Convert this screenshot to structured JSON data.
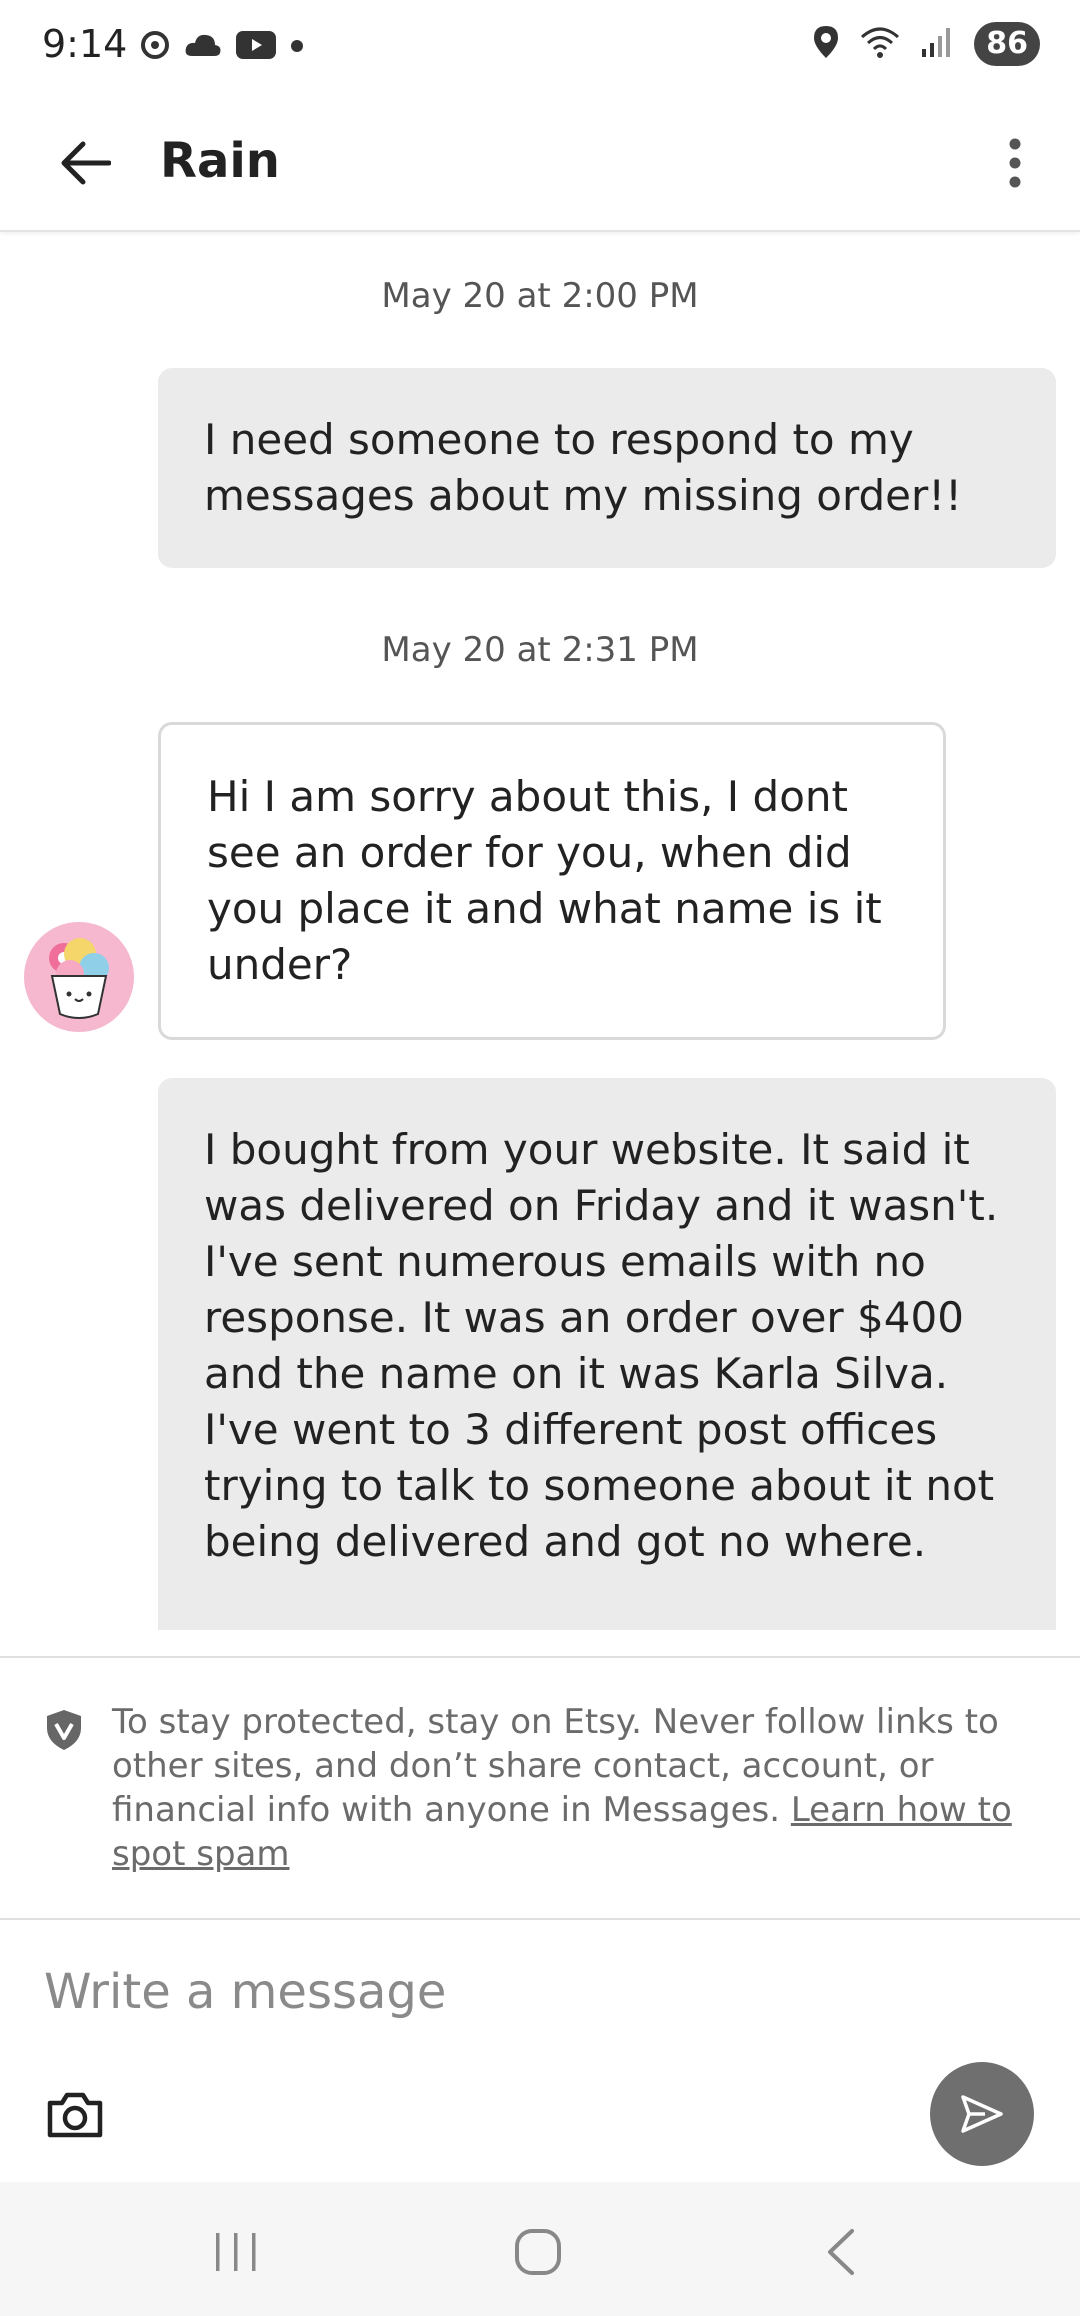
{
  "status_bar": {
    "time": "9:14",
    "battery": "86",
    "left_icons": [
      "chrome-icon",
      "cloud-icon",
      "youtube-icon",
      "dot-icon"
    ],
    "right_icons": [
      "location-icon",
      "wifi-icon",
      "signal-icon"
    ]
  },
  "header": {
    "title": "Rain",
    "back_icon": "arrow-left-icon",
    "menu_icon": "more-vertical-icon"
  },
  "conversation": {
    "messages": [
      {
        "type": "timestamp",
        "text": "May 20 at 2:00 PM"
      },
      {
        "type": "sent",
        "text": "I need someone to respond to my messages about my missing order!!"
      },
      {
        "type": "timestamp",
        "text": "May 20 at 2:31 PM"
      },
      {
        "type": "received",
        "text": "Hi I am sorry about this, I dont see an order for you, when did you place it and what name is it under?"
      },
      {
        "type": "sent",
        "text": "I bought from your website. It said it was delivered on Friday and it wasn't. I've sent numerous emails with no response. It was an order over $400 and the name on it was Karla Silva. I've went to 3 different post offices trying to talk to someone about it not being delivered and got no where."
      }
    ]
  },
  "safety_notice": {
    "text": "To stay protected, stay on Etsy. Never follow links to other sites, and don’t share contact, account, or financial info with anyone in Messages. ",
    "link_text": "Learn how to spot spam",
    "icon": "shield-icon"
  },
  "composer": {
    "placeholder": "Write a message",
    "camera_icon": "camera-icon",
    "send_icon": "send-icon"
  },
  "nav_bar": {
    "icons": [
      "recent-apps-icon",
      "home-icon",
      "back-icon"
    ]
  },
  "colors": {
    "sent_bubble": "#ebebeb",
    "received_border": "#d9d9d9",
    "send_button": "#6f6f6f",
    "avatar_bg": "#f5b8cf"
  }
}
